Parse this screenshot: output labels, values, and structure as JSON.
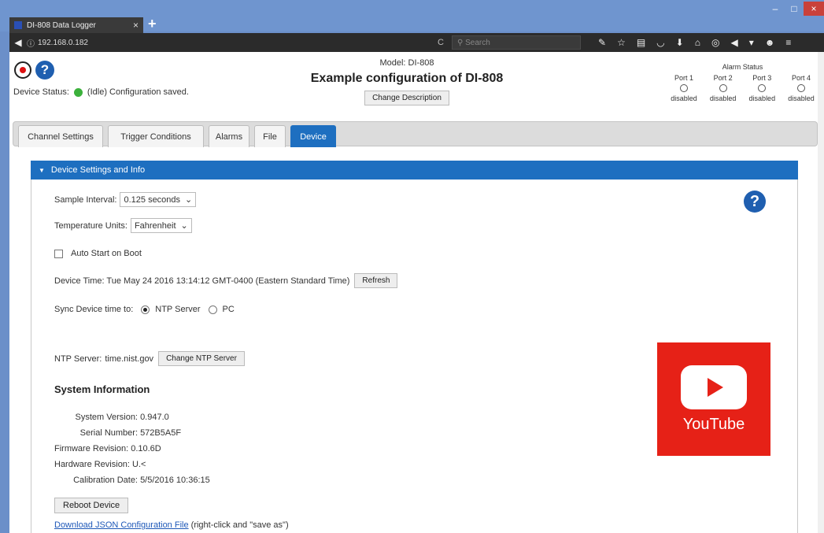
{
  "browser": {
    "tab_title": "DI-808 Data Logger",
    "tab_close": "×",
    "new_tab": "+",
    "url": "192.168.0.182",
    "search_placeholder": "Search",
    "window_controls": [
      "–",
      "□",
      "×"
    ]
  },
  "header": {
    "device_status_label": "Device Status:",
    "device_status_text": "(Idle) Configuration saved.",
    "model": "Model: DI-808",
    "config_title": "Example configuration of DI-808",
    "change_description": "Change Description",
    "alarm_status_title": "Alarm Status",
    "ports": [
      {
        "name": "Port 1",
        "status": "disabled"
      },
      {
        "name": "Port 2",
        "status": "disabled"
      },
      {
        "name": "Port 3",
        "status": "disabled"
      },
      {
        "name": "Port 4",
        "status": "disabled"
      }
    ]
  },
  "tabs": [
    "Channel Settings",
    "Trigger Conditions",
    "Alarms",
    "File",
    "Device"
  ],
  "active_tab": "Device",
  "panel": {
    "title": "Device Settings and Info",
    "sample_interval_label": "Sample Interval:",
    "sample_interval_value": "0.125 seconds",
    "temp_units_label": "Temperature Units:",
    "temp_units_value": "Fahrenheit",
    "auto_start_label": "Auto Start on Boot",
    "device_time_text": "Device Time: Tue May 24 2016 13:14:12 GMT-0400 (Eastern Standard Time)",
    "refresh_button": "Refresh",
    "sync_label": "Sync Device time to:",
    "sync_ntp": "NTP Server",
    "sync_pc": "PC",
    "ntp_server_label": "NTP Server:",
    "ntp_server_value": "time.nist.gov",
    "change_ntp_button": "Change NTP Server",
    "system_info_title": "System Information",
    "system_info": [
      {
        "key": "System Version:",
        "value": "0.947.0"
      },
      {
        "key": "Serial Number:",
        "value": "572B5A5F"
      },
      {
        "key": "Firmware Revision:",
        "value": "0.10.6D"
      },
      {
        "key": "Hardware Revision:",
        "value": "U.<"
      },
      {
        "key": "Calibration Date:",
        "value": "5/5/2016 10:36:15"
      }
    ],
    "reboot_button": "Reboot Device",
    "download_link": "Download JSON Configuration File",
    "download_hint": "(right-click and \"save as\")"
  },
  "youtube_label": "YouTube",
  "colors": {
    "accent": "#1e6fc0",
    "status_ok": "#3cb13c",
    "youtube": "#e62117"
  }
}
